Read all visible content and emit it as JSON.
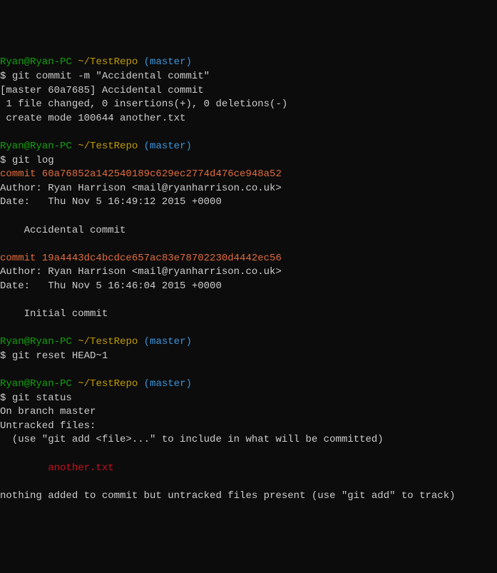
{
  "prompt1": {
    "user": "Ryan@Ryan-PC",
    "path": "~/TestRepo",
    "branch": "(master)",
    "dollar": "$",
    "cmd": "git commit -m \"Accidental commit\""
  },
  "commit_output": {
    "line1": "[master 60a7685] Accidental commit",
    "line2": " 1 file changed, 0 insertions(+), 0 deletions(-)",
    "line3": " create mode 100644 another.txt"
  },
  "prompt2": {
    "user": "Ryan@Ryan-PC",
    "path": "~/TestRepo",
    "branch": "(master)",
    "dollar": "$",
    "cmd": "git log"
  },
  "log": {
    "commit1_hash": "commit 60a76852a142540189c629ec2774d476ce948a52",
    "commit1_author": "Author: Ryan Harrison <mail@ryanharrison.co.uk>",
    "commit1_date": "Date:   Thu Nov 5 16:49:12 2015 +0000",
    "commit1_msg": "    Accidental commit",
    "commit2_hash": "commit 19a4443dc4bcdce657ac83e78702230d4442ec56",
    "commit2_author": "Author: Ryan Harrison <mail@ryanharrison.co.uk>",
    "commit2_date": "Date:   Thu Nov 5 16:46:04 2015 +0000",
    "commit2_msg": "    Initial commit"
  },
  "prompt3": {
    "user": "Ryan@Ryan-PC",
    "path": "~/TestRepo",
    "branch": "(master)",
    "dollar": "$",
    "cmd": "git reset HEAD~1"
  },
  "prompt4": {
    "user": "Ryan@Ryan-PC",
    "path": "~/TestRepo",
    "branch": "(master)",
    "dollar": "$",
    "cmd": "git status"
  },
  "status": {
    "branch": "On branch master",
    "untracked_header": "Untracked files:",
    "untracked_hint": "  (use \"git add <file>...\" to include in what will be committed)",
    "untracked_file": "        another.txt",
    "nothing": "nothing added to commit but untracked files present (use \"git add\" to track)"
  }
}
